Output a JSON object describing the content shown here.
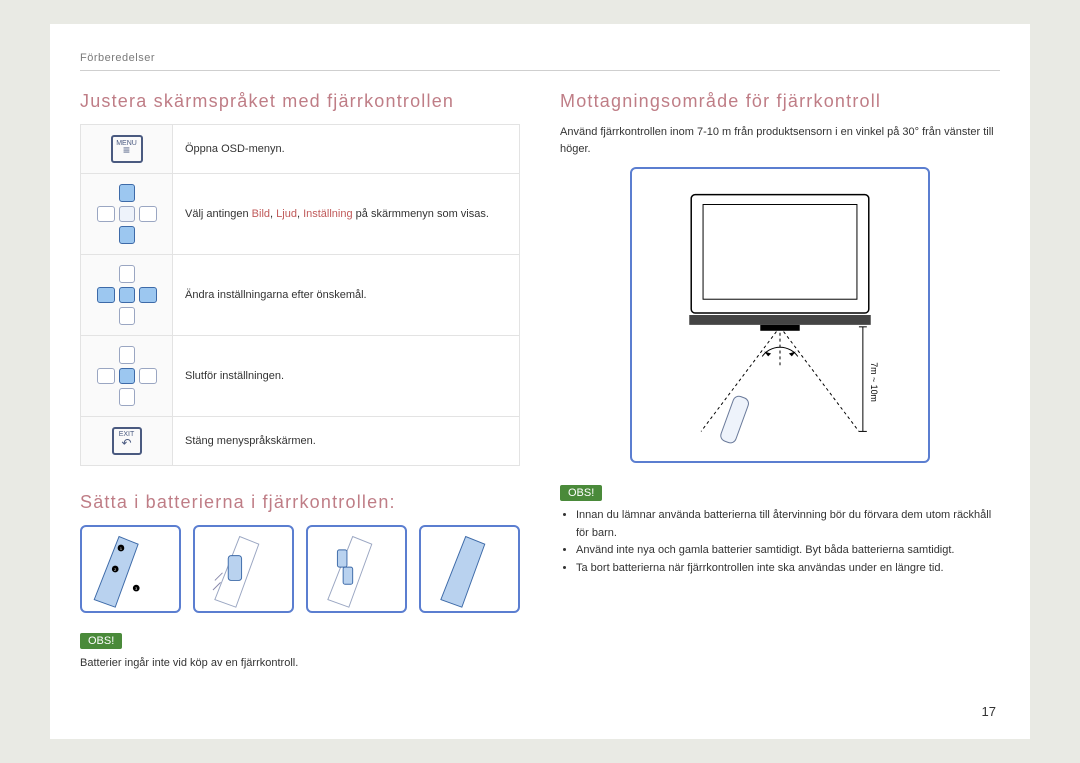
{
  "header": {
    "section": "Förberedelser"
  },
  "left": {
    "h1": "Justera skärmspråket med fjärrkontrollen",
    "table": {
      "row1": {
        "text": "Öppna OSD-menyn."
      },
      "row2": {
        "prefix": "Välj antingen ",
        "word1": "Bild",
        "sep": ", ",
        "word2": "Ljud",
        "word3": "Inställning",
        "suffix": " på skärmmenyn som visas."
      },
      "row3": {
        "text": "Ändra inställningarna efter önskemål."
      },
      "row4": {
        "text": "Slutför inställningen."
      },
      "row5": {
        "text": "Stäng menyspråkskärmen."
      }
    },
    "h2": "Sätta i batterierna i fjärrkontrollen:",
    "obs_label": "OBS!",
    "obs_text": "Batterier ingår inte vid köp av en fjärrkontroll."
  },
  "right": {
    "h1": "Mottagningsområde för fjärrkontroll",
    "intro": "Använd fjärrkontrollen inom 7-10 m från produktsensorn i en vinkel på 30° från vänster till höger.",
    "distance_label": "7m ~ 10m",
    "obs_label": "OBS!",
    "obs_items": [
      "Innan du lämnar använda batterierna till återvinning bör du förvara dem utom räckhåll för barn.",
      "Använd inte nya och gamla batterier samtidigt. Byt båda batterierna samtidigt.",
      "Ta bort batterierna när fjärrkontrollen inte ska användas under en längre tid."
    ]
  },
  "icons": {
    "menu": "MENU",
    "exit": "EXIT"
  },
  "page_number": "17"
}
